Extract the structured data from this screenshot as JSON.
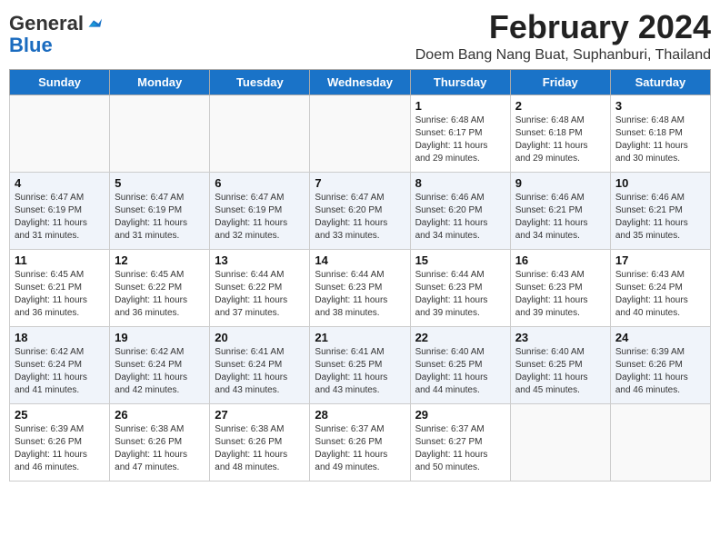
{
  "header": {
    "logo_line1": "General",
    "logo_line2": "Blue",
    "title": "February 2024",
    "subtitle": "Doem Bang Nang Buat, Suphanburi, Thailand"
  },
  "days_of_week": [
    "Sunday",
    "Monday",
    "Tuesday",
    "Wednesday",
    "Thursday",
    "Friday",
    "Saturday"
  ],
  "weeks": [
    [
      {
        "day": "",
        "info": ""
      },
      {
        "day": "",
        "info": ""
      },
      {
        "day": "",
        "info": ""
      },
      {
        "day": "",
        "info": ""
      },
      {
        "day": "1",
        "info": "Sunrise: 6:48 AM\nSunset: 6:17 PM\nDaylight: 11 hours\nand 29 minutes."
      },
      {
        "day": "2",
        "info": "Sunrise: 6:48 AM\nSunset: 6:18 PM\nDaylight: 11 hours\nand 29 minutes."
      },
      {
        "day": "3",
        "info": "Sunrise: 6:48 AM\nSunset: 6:18 PM\nDaylight: 11 hours\nand 30 minutes."
      }
    ],
    [
      {
        "day": "4",
        "info": "Sunrise: 6:47 AM\nSunset: 6:19 PM\nDaylight: 11 hours\nand 31 minutes."
      },
      {
        "day": "5",
        "info": "Sunrise: 6:47 AM\nSunset: 6:19 PM\nDaylight: 11 hours\nand 31 minutes."
      },
      {
        "day": "6",
        "info": "Sunrise: 6:47 AM\nSunset: 6:19 PM\nDaylight: 11 hours\nand 32 minutes."
      },
      {
        "day": "7",
        "info": "Sunrise: 6:47 AM\nSunset: 6:20 PM\nDaylight: 11 hours\nand 33 minutes."
      },
      {
        "day": "8",
        "info": "Sunrise: 6:46 AM\nSunset: 6:20 PM\nDaylight: 11 hours\nand 34 minutes."
      },
      {
        "day": "9",
        "info": "Sunrise: 6:46 AM\nSunset: 6:21 PM\nDaylight: 11 hours\nand 34 minutes."
      },
      {
        "day": "10",
        "info": "Sunrise: 6:46 AM\nSunset: 6:21 PM\nDaylight: 11 hours\nand 35 minutes."
      }
    ],
    [
      {
        "day": "11",
        "info": "Sunrise: 6:45 AM\nSunset: 6:21 PM\nDaylight: 11 hours\nand 36 minutes."
      },
      {
        "day": "12",
        "info": "Sunrise: 6:45 AM\nSunset: 6:22 PM\nDaylight: 11 hours\nand 36 minutes."
      },
      {
        "day": "13",
        "info": "Sunrise: 6:44 AM\nSunset: 6:22 PM\nDaylight: 11 hours\nand 37 minutes."
      },
      {
        "day": "14",
        "info": "Sunrise: 6:44 AM\nSunset: 6:23 PM\nDaylight: 11 hours\nand 38 minutes."
      },
      {
        "day": "15",
        "info": "Sunrise: 6:44 AM\nSunset: 6:23 PM\nDaylight: 11 hours\nand 39 minutes."
      },
      {
        "day": "16",
        "info": "Sunrise: 6:43 AM\nSunset: 6:23 PM\nDaylight: 11 hours\nand 39 minutes."
      },
      {
        "day": "17",
        "info": "Sunrise: 6:43 AM\nSunset: 6:24 PM\nDaylight: 11 hours\nand 40 minutes."
      }
    ],
    [
      {
        "day": "18",
        "info": "Sunrise: 6:42 AM\nSunset: 6:24 PM\nDaylight: 11 hours\nand 41 minutes."
      },
      {
        "day": "19",
        "info": "Sunrise: 6:42 AM\nSunset: 6:24 PM\nDaylight: 11 hours\nand 42 minutes."
      },
      {
        "day": "20",
        "info": "Sunrise: 6:41 AM\nSunset: 6:24 PM\nDaylight: 11 hours\nand 43 minutes."
      },
      {
        "day": "21",
        "info": "Sunrise: 6:41 AM\nSunset: 6:25 PM\nDaylight: 11 hours\nand 43 minutes."
      },
      {
        "day": "22",
        "info": "Sunrise: 6:40 AM\nSunset: 6:25 PM\nDaylight: 11 hours\nand 44 minutes."
      },
      {
        "day": "23",
        "info": "Sunrise: 6:40 AM\nSunset: 6:25 PM\nDaylight: 11 hours\nand 45 minutes."
      },
      {
        "day": "24",
        "info": "Sunrise: 6:39 AM\nSunset: 6:26 PM\nDaylight: 11 hours\nand 46 minutes."
      }
    ],
    [
      {
        "day": "25",
        "info": "Sunrise: 6:39 AM\nSunset: 6:26 PM\nDaylight: 11 hours\nand 46 minutes."
      },
      {
        "day": "26",
        "info": "Sunrise: 6:38 AM\nSunset: 6:26 PM\nDaylight: 11 hours\nand 47 minutes."
      },
      {
        "day": "27",
        "info": "Sunrise: 6:38 AM\nSunset: 6:26 PM\nDaylight: 11 hours\nand 48 minutes."
      },
      {
        "day": "28",
        "info": "Sunrise: 6:37 AM\nSunset: 6:26 PM\nDaylight: 11 hours\nand 49 minutes."
      },
      {
        "day": "29",
        "info": "Sunrise: 6:37 AM\nSunset: 6:27 PM\nDaylight: 11 hours\nand 50 minutes."
      },
      {
        "day": "",
        "info": ""
      },
      {
        "day": "",
        "info": ""
      }
    ]
  ]
}
